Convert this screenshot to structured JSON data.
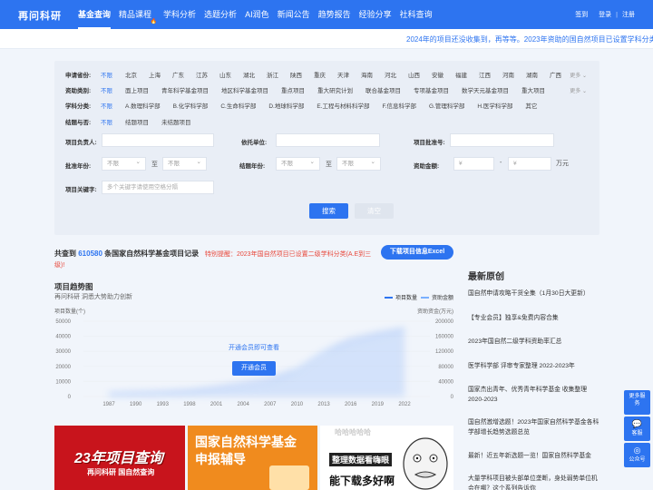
{
  "header": {
    "logo": "再问科研",
    "nav": [
      "基金查询",
      "精品课程",
      "学科分析",
      "选题分析",
      "AI润色",
      "新闻公告",
      "趋势报告",
      "经验分享",
      "社科查询"
    ],
    "active_nav": 0,
    "hot_badge": "🔥",
    "auth": {
      "checkin": "签到",
      "login": "登录",
      "register": "注册"
    }
  },
  "marquee": "2024年的项目还没收集到，再等等。2023年资助的国自然项目已设置学科分类",
  "filter": {
    "rows": [
      {
        "label": "申请省份:",
        "options": [
          "不限",
          "北京",
          "上海",
          "广东",
          "江苏",
          "山东",
          "湖北",
          "浙江",
          "陕西",
          "重庆",
          "天津",
          "海南",
          "河北",
          "山西",
          "安徽",
          "福建",
          "江西",
          "河南",
          "湖南",
          "广西"
        ],
        "more": "更多 ⌄"
      },
      {
        "label": "资助类别:",
        "options": [
          "不限",
          "面上项目",
          "青年科学基金项目",
          "地区科学基金项目",
          "重点项目",
          "重大研究计划",
          "联合基金项目",
          "专项基金项目",
          "数学天元基金项目",
          "重大项目"
        ],
        "more": "更多 ⌄"
      },
      {
        "label": "学科分类:",
        "options": [
          "不限",
          "A.数理科学部",
          "B.化学科学部",
          "C.生命科学部",
          "D.地球科学部",
          "E.工程与材料科学部",
          "F.信息科学部",
          "G.管理科学部",
          "H.医学科学部",
          "其它"
        ]
      },
      {
        "label": "结题与否:",
        "options": [
          "不限",
          "结题项目",
          "未结题项目"
        ]
      }
    ],
    "leader_label": "项目负责人:",
    "unit_label": "依托单位:",
    "approval_label": "项目批准号:",
    "approval_year_label": "批准年份:",
    "end_year_label": "结题年份:",
    "amount_label": "资助金额:",
    "unlimited": "不限",
    "to": "至",
    "yen": "¥",
    "dash": "-",
    "wan": "万元",
    "keyword_label": "项目关键字:",
    "keyword_placeholder": "多个关键字请使用空格分隔",
    "search_btn": "搜索",
    "clear_btn": "清空"
  },
  "result": {
    "prefix": "共查到",
    "count": "610580",
    "suffix": "条国家自然科学基金项目记录",
    "tip": "特别提醒：2023年国自然项目已设置二级学科分类(A.E到三级)!",
    "download_btn": "下载项目信息Excel"
  },
  "chart": {
    "title": "项目趋势图",
    "subtitle": "再问科研 洞悉大势助力创新",
    "legend": [
      "项目数量",
      "资助金额"
    ],
    "left_axis_label": "项目数量(个)",
    "right_axis_label": "资助资金(万元)",
    "overlay_text": "开通会员即可查看",
    "open_btn": "开通会员"
  },
  "chart_data": {
    "type": "line",
    "x": [
      "1987",
      "1990",
      "1993",
      "1998",
      "2001",
      "2004",
      "2007",
      "2010",
      "2013",
      "2016",
      "2019",
      "2022"
    ],
    "y_left_ticks": [
      "50000",
      "40000",
      "30000",
      "20000",
      "10000",
      "0"
    ],
    "y_right_ticks": [
      "200000",
      "160000",
      "120000",
      "80000",
      "40000",
      "0"
    ],
    "ylim_left": [
      0,
      50000
    ],
    "ylim_right": [
      0,
      200000
    ],
    "series": [
      {
        "name": "项目数量",
        "values": [
          2000,
          2500,
          3000,
          4000,
          6000,
          9000,
          12000,
          18000,
          30000,
          38000,
          42000,
          45000
        ]
      },
      {
        "name": "资助金额",
        "values": [
          4000,
          5000,
          6000,
          9000,
          14000,
          22000,
          36000,
          70000,
          120000,
          140000,
          160000,
          175000
        ]
      }
    ],
    "grid": true,
    "legend_position": "top-right"
  },
  "banners": [
    {
      "main": "23年项目查询",
      "sub": "再问科研 国自然查询"
    },
    {
      "main": "国家自然科学基金",
      "sub": "申报辅导"
    },
    {
      "main": "整理数据看嗨眼",
      "sub": "能下载多好啊",
      "deco": "哈哈哈哈哈"
    }
  ],
  "sidebar": {
    "title": "最新原创",
    "articles": [
      "国自然申请攻略干货全集（1月30日大更新）",
      "【专业会员】独享&免费内容合集",
      "2023年国自然二级学科资助率汇总",
      "医学科学部 评审专家整理 2022-2023年",
      "国家杰出青年、优秀青年科学基金 收集整理 2020-2023",
      "国自然激增选题！2023年国家自然科学基金各科学部增长趋势选题总览",
      "最新！近五年新选题一览！国家自然科学基金",
      "大量学科项目被头部单位垄断，身处弱势单位机会在哪？这个系列告诉你"
    ]
  },
  "floating": {
    "more": "更多服务",
    "service": "客服",
    "official": "公众号"
  }
}
